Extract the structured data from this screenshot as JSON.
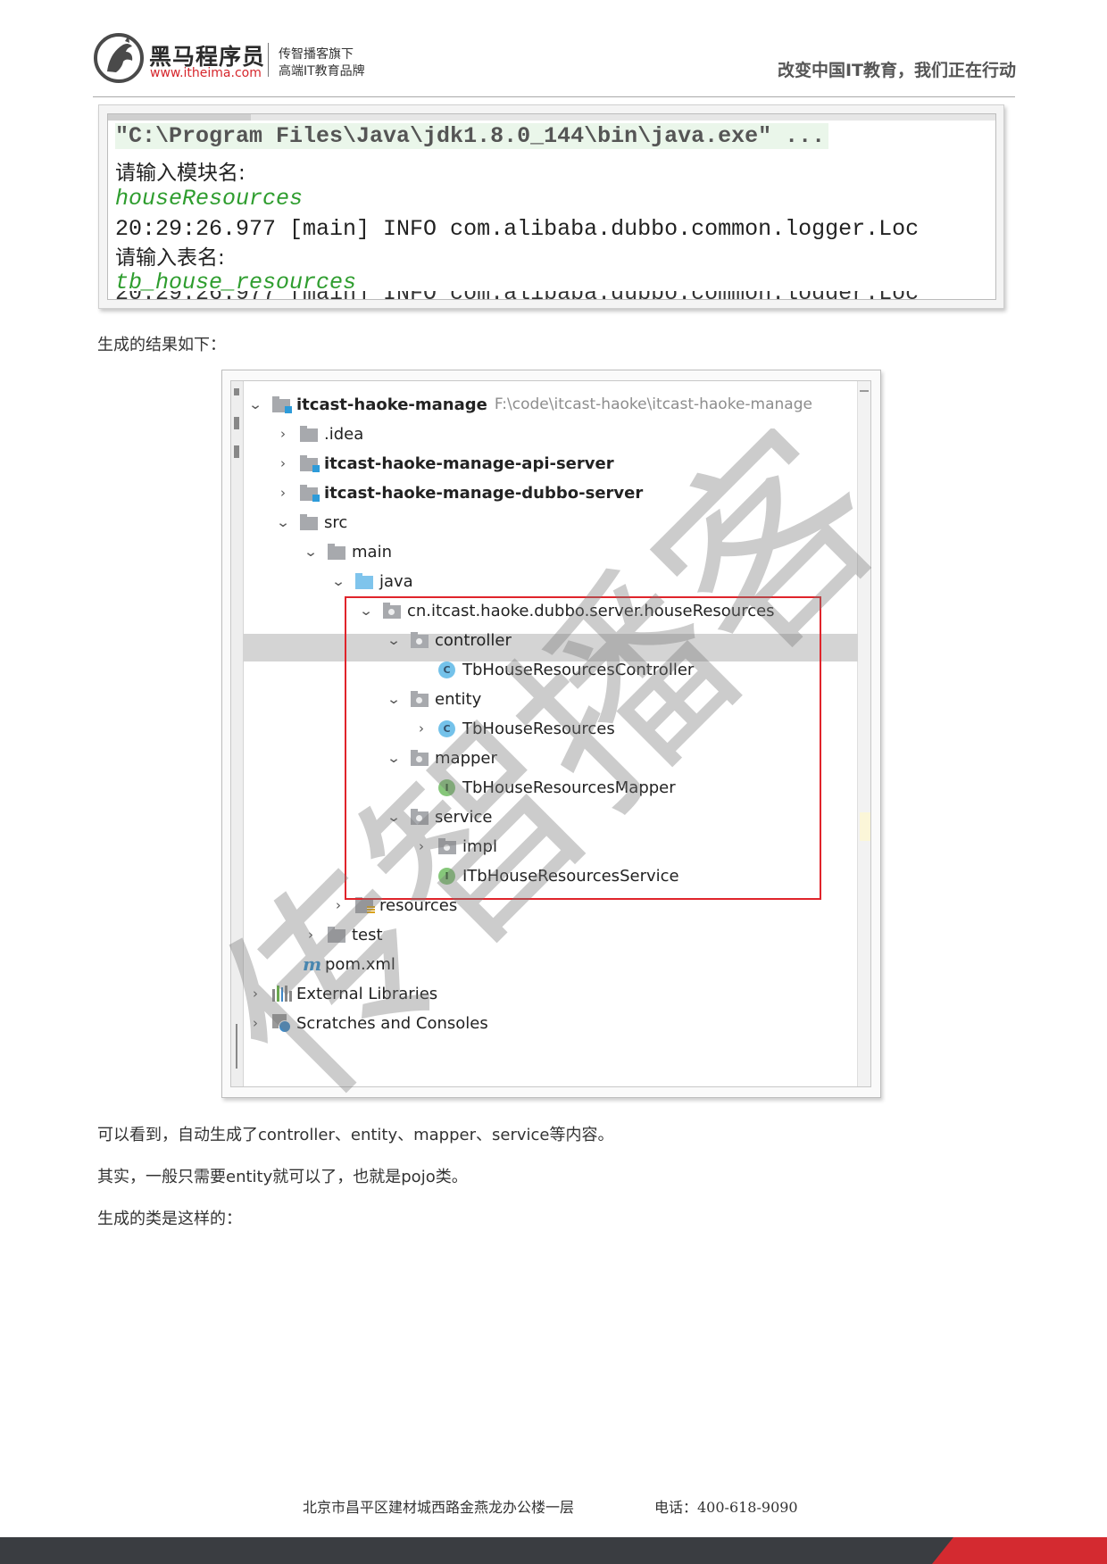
{
  "header": {
    "brand_cn": "黑马程序员",
    "brand_url": "www.itheima.com",
    "tagline_1": "传智播客旗下",
    "tagline_2": "高端IT教育品牌",
    "slogan": "改变中国IT教育，我们正在行动"
  },
  "console": {
    "command": "\"C:\\Program Files\\Java\\jdk1.8.0_144\\bin\\java.exe\" ...",
    "prompt_module": "请输入模块名:",
    "input_module": "houseResources",
    "log_line": "20:29:26.977 [main] INFO com.alibaba.dubbo.common.logger.Loc",
    "prompt_table": "请输入表名:",
    "input_table": "tb_house_resources"
  },
  "paragraphs": {
    "result_intro": "生成的结果如下：",
    "auto_generated": "可以看到，自动生成了controller、entity、mapper、service等内容。",
    "entity_only": "其实，一般只需要entity就可以了，也就是pojo类。",
    "class_intro": "生成的类是这样的："
  },
  "tree": {
    "root": {
      "label": "itcast-haoke-manage",
      "path": "F:\\code\\itcast-haoke\\itcast-haoke-manage"
    },
    "idea": ".idea",
    "api_server": "itcast-haoke-manage-api-server",
    "dubbo_server": "itcast-haoke-manage-dubbo-server",
    "src": "src",
    "main": "main",
    "java": "java",
    "package": "cn.itcast.haoke.dubbo.server.houseResources",
    "controller": "controller",
    "controller_class": "TbHouseResourcesController",
    "entity": "entity",
    "entity_class": "TbHouseResources",
    "mapper": "mapper",
    "mapper_interface": "TbHouseResourcesMapper",
    "service": "service",
    "impl": "impl",
    "service_interface": "ITbHouseResourcesService",
    "resources": "resources",
    "test": "test",
    "pom": "pom.xml",
    "external_libraries": "External Libraries",
    "scratches": "Scratches and Consoles",
    "class_badge": "C",
    "interface_badge": "I",
    "maven_badge": "m"
  },
  "watermark": "传智播客",
  "footer": {
    "address": "北京市昌平区建材城西路金燕龙办公楼一层",
    "phone": "电话：400-618-9090"
  },
  "colors": {
    "brand_red": "#d6262c",
    "console_green": "#2e9d2e",
    "highlight_box": "#e0242b",
    "footer_dark": "#3a3d41"
  }
}
